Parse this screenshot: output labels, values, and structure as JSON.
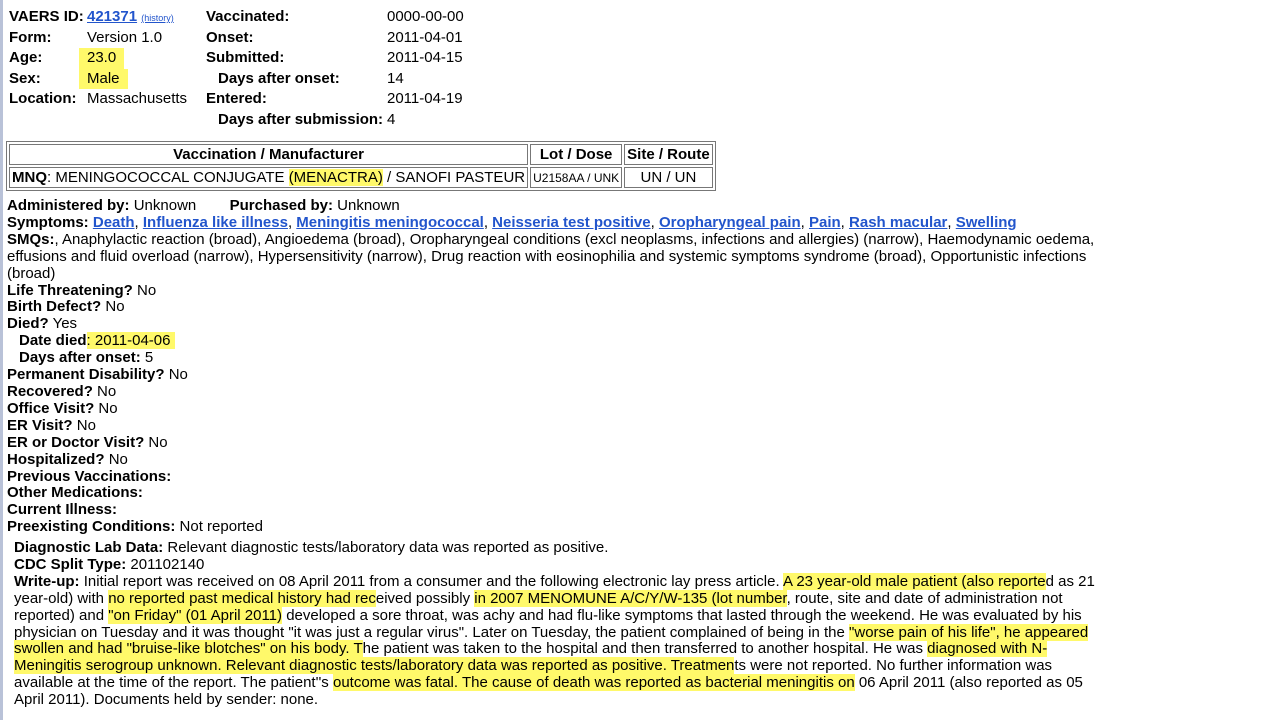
{
  "header": {
    "vaers_id_label": "VAERS ID:",
    "vaers_id": "421371",
    "history_link": "(history)",
    "form_label": "Form:",
    "form_value": "Version 1.0",
    "age_label": "Age:",
    "age_value": "23.0",
    "sex_label": "Sex:",
    "sex_value": "Male",
    "location_label": "Location:",
    "location_value": "Massachusetts",
    "vaccinated_label": "Vaccinated:",
    "vaccinated_value": "0000-00-00",
    "onset_label": "Onset:",
    "onset_value": "2011-04-01",
    "submitted_label": "Submitted:",
    "submitted_value": "2011-04-15",
    "days_after_onset_label": "Days after onset:",
    "days_after_onset_value": "14",
    "entered_label": "Entered:",
    "entered_value": "2011-04-19",
    "days_after_submission_label": "Days after submission:",
    "days_after_submission_value": "4"
  },
  "vaccination_table": {
    "headers": [
      "Vaccination / Manufacturer",
      "Lot / Dose",
      "Site / Route"
    ],
    "row": {
      "code": "MNQ",
      "name_pre": ": MENINGOCOCCAL CONJUGATE ",
      "name_hl": "(MENACTRA)",
      "name_post": " / SANOFI PASTEUR",
      "lot": "U2158AA / UNK",
      "site": "UN / UN"
    }
  },
  "details": {
    "administered_label": "Administered by:",
    "administered_value": "Unknown",
    "purchased_label": "Purchased by:",
    "purchased_value": "Unknown",
    "symptoms_label": "Symptoms:",
    "symptoms": [
      "Death",
      "Influenza like illness",
      "Meningitis meningococcal",
      "Neisseria test positive",
      "Oropharyngeal pain",
      "Pain",
      "Rash macular",
      "Swelling"
    ],
    "smqs_label": "SMQs:",
    "smqs_value": ", Anaphylactic reaction (broad), Angioedema (broad), Oropharyngeal conditions (excl neoplasms, infections and allergies) (narrow), Haemodynamic oedema, effusions and fluid overload (narrow), Hypersensitivity (narrow), Drug reaction with eosinophilia and systemic symptoms syndrome (broad), Opportunistic infections (broad)",
    "life_threatening_label": "Life Threatening?",
    "life_threatening_value": "No",
    "birth_defect_label": "Birth Defect?",
    "birth_defect_value": "No",
    "died_label": "Died?",
    "died_value": "Yes",
    "date_died_label": "Date died",
    "date_died_value": "2011-04-06",
    "days_after_onset2_label": "Days after onset:",
    "days_after_onset2_value": "5",
    "permanent_disability_label": "Permanent Disability?",
    "permanent_disability_value": "No",
    "recovered_label": "Recovered?",
    "recovered_value": "No",
    "office_visit_label": "Office Visit?",
    "office_visit_value": "No",
    "er_visit_label": "ER Visit?",
    "er_visit_value": "No",
    "er_doctor_label": "ER or Doctor Visit?",
    "er_doctor_value": "No",
    "hospitalized_label": "Hospitalized?",
    "hospitalized_value": "No",
    "previous_vacc_label": "Previous Vaccinations:",
    "other_meds_label": "Other Medications:",
    "current_illness_label": "Current Illness:",
    "preexisting_label": "Preexisting Conditions:",
    "preexisting_value": "Not reported"
  },
  "lower": {
    "diag_label": "Diagnostic Lab Data:",
    "diag_value": "Relevant diagnostic tests/laboratory data was reported as positive.",
    "cdc_label": "CDC Split Type:",
    "cdc_value": "201102140",
    "writeup_label": "Write-up:",
    "w1": "Initial report was received on 08 April 2011 from a consumer and the following electronic lay press article. ",
    "w2": "A 23 year-old male patient (also reporte",
    "w3": "d as 21 year-old) with ",
    "w4": "no reported past medical history had rec",
    "w5": "eived possibly ",
    "w6": "in 2007 MENOMUNE A/C/Y/W-135 (lot number",
    "w7": ", route, site and date of administration not reported) and ",
    "w8": "\"on Friday\" (01 April 2011)",
    "w9": " developed a sore throat, was achy and had flu-like symptoms that lasted through the weekend. He was evaluated by his physician on Tuesday and it was thought \"it was just a regular virus\". Later on Tuesday, the patient complained of being in the ",
    "w10": "\"worse pain of his life\", he appeared swollen and had \"bruise-like blotches\" on his body. T",
    "w11": "he patient was taken to the hospital and then transferred to another hospital. He was ",
    "w12": "diagnosed with N-Meningitis serogroup unknown. Relevant diagnostic tests/laboratory data was reported as positive. Treatmen",
    "w13": "ts were not reported. No further information was available at the time of the report. The patient''s ",
    "w14": "outcome was fatal. The cause of death was reported as bacterial meningitis on",
    "w15": " 06 April 2011 (also reported as 05 April 2011). Documents held by sender: none."
  }
}
